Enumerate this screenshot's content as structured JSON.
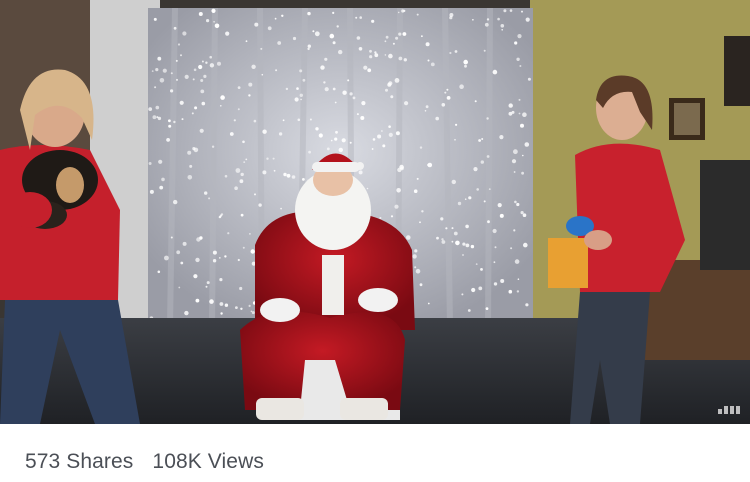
{
  "stats": {
    "shares": "573 Shares",
    "views": "108K Views"
  },
  "video": {
    "quality_icon": "signal-bars-icon"
  }
}
